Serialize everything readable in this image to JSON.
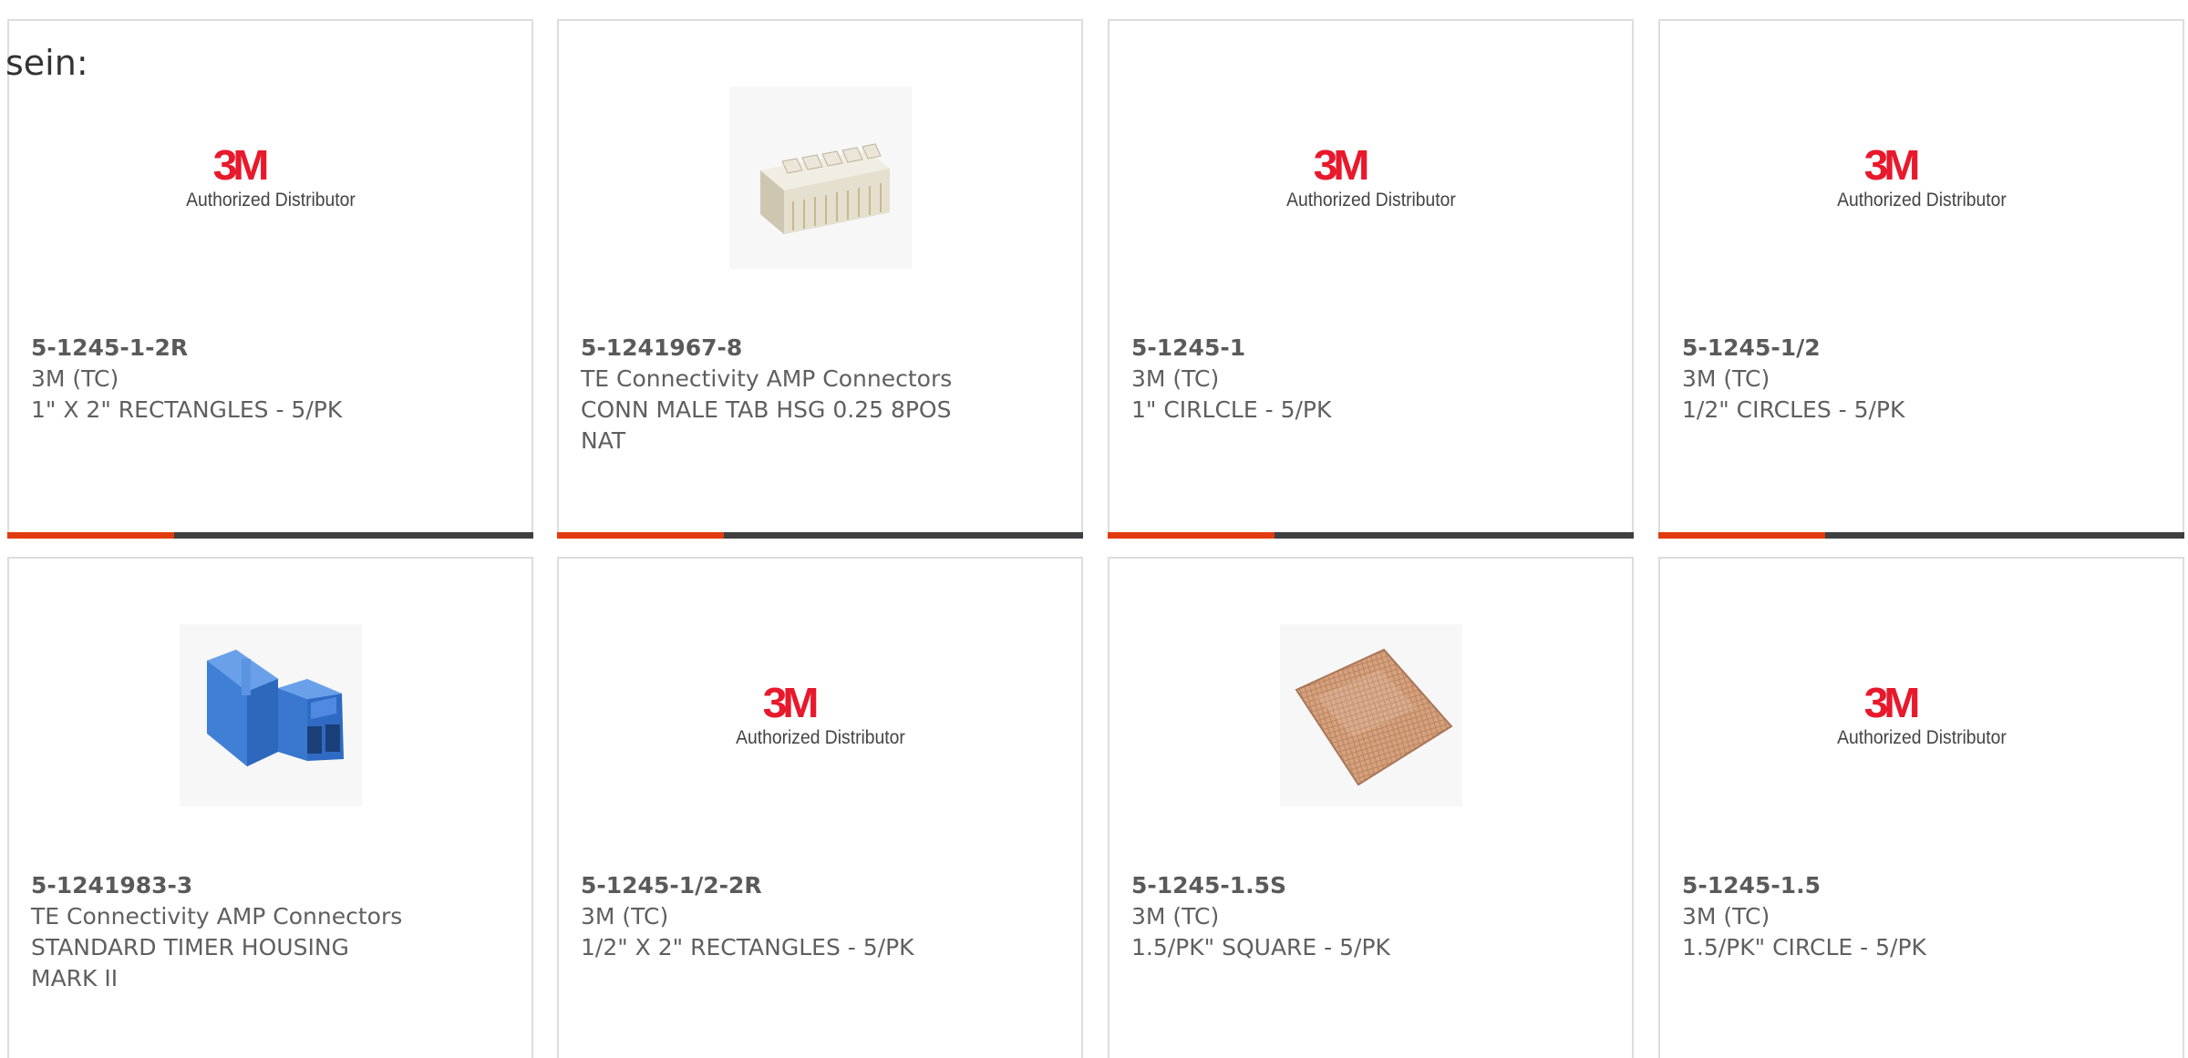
{
  "lead_text": "sein:",
  "logo": {
    "mark": "3M",
    "tagline": "Authorized Distributor"
  },
  "colors": {
    "accent": "#e23b10",
    "bar": "#3d3f41",
    "border": "#dddddd",
    "logo_red": "#e8192c",
    "connector_blue": "#3d7fd8"
  },
  "products": [
    {
      "part_number": "5-1245-1-2R",
      "manufacturer": "3M (TC)",
      "description": "1\" X 2\" RECTANGLES - 5/PK",
      "image": "3m-logo"
    },
    {
      "part_number": "5-1241967-8",
      "manufacturer": "TE Connectivity AMP Connectors",
      "description": "CONN MALE TAB HSG 0.25 8POS NAT",
      "image": "white-connector-housing"
    },
    {
      "part_number": "5-1245-1",
      "manufacturer": "3M (TC)",
      "description": "1\" CIRLCLE - 5/PK",
      "image": "3m-logo"
    },
    {
      "part_number": "5-1245-1/2",
      "manufacturer": "3M (TC)",
      "description": "1/2\" CIRCLES - 5/PK",
      "image": "3m-logo"
    },
    {
      "part_number": "5-1241983-3",
      "manufacturer": "TE Connectivity AMP Connectors",
      "description": "STANDARD TIMER HOUSING MARK II",
      "image": "blue-connector-housing"
    },
    {
      "part_number": "5-1245-1/2-2R",
      "manufacturer": "3M (TC)",
      "description": "1/2\" X 2\" RECTANGLES - 5/PK",
      "image": "3m-logo"
    },
    {
      "part_number": "5-1245-1.5S",
      "manufacturer": "3M (TC)",
      "description": "1.5/PK\" SQUARE - 5/PK",
      "image": "copper-foil-square"
    },
    {
      "part_number": "5-1245-1.5",
      "manufacturer": "3M (TC)",
      "description": "1.5/PK\" CIRCLE - 5/PK",
      "image": "3m-logo"
    }
  ]
}
